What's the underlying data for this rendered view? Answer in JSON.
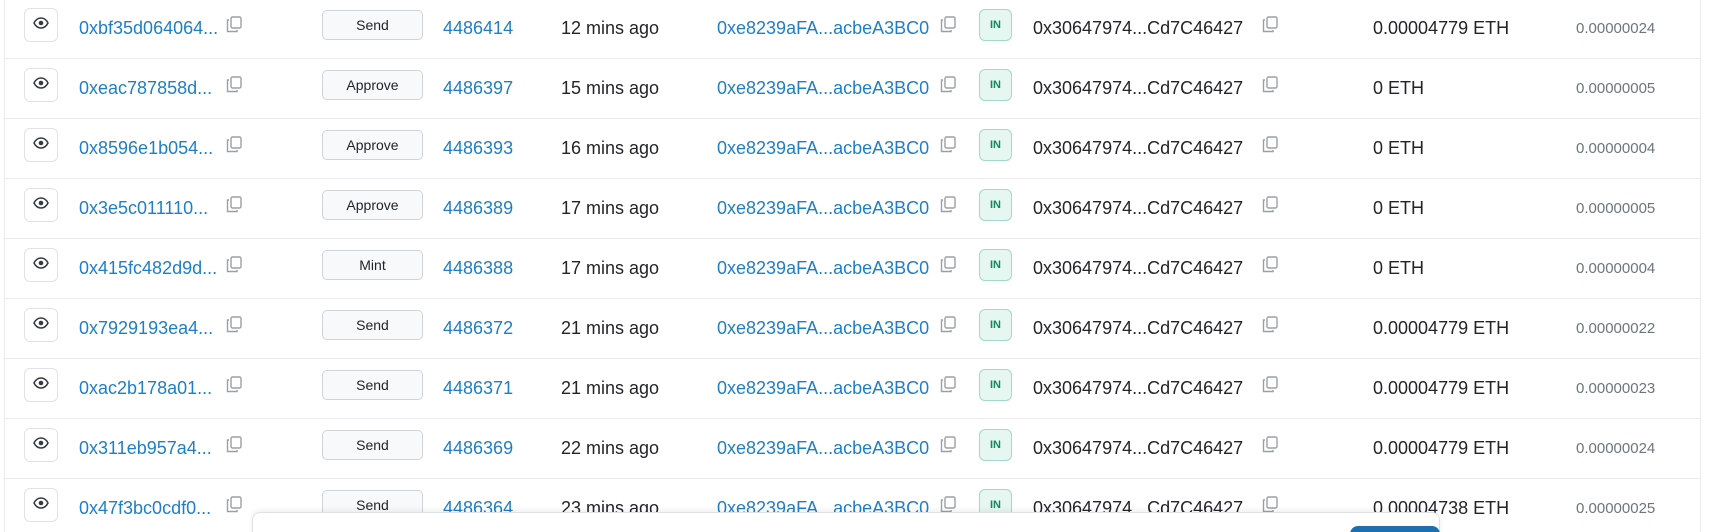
{
  "transactions": [
    {
      "hash": "0xbf35d064064...",
      "method": "Send",
      "block": "4486414",
      "age": "12 mins ago",
      "from": "0xe8239aFA...acbeA3BC0",
      "direction": "IN",
      "to": "0x30647974...Cd7C46427",
      "value": "0.00004779 ETH",
      "fee": "0.00000024"
    },
    {
      "hash": "0xeac787858d...",
      "method": "Approve",
      "block": "4486397",
      "age": "15 mins ago",
      "from": "0xe8239aFA...acbeA3BC0",
      "direction": "IN",
      "to": "0x30647974...Cd7C46427",
      "value": "0 ETH",
      "fee": "0.00000005"
    },
    {
      "hash": "0x8596e1b054...",
      "method": "Approve",
      "block": "4486393",
      "age": "16 mins ago",
      "from": "0xe8239aFA...acbeA3BC0",
      "direction": "IN",
      "to": "0x30647974...Cd7C46427",
      "value": "0 ETH",
      "fee": "0.00000004"
    },
    {
      "hash": "0x3e5c011110...",
      "method": "Approve",
      "block": "4486389",
      "age": "17 mins ago",
      "from": "0xe8239aFA...acbeA3BC0",
      "direction": "IN",
      "to": "0x30647974...Cd7C46427",
      "value": "0 ETH",
      "fee": "0.00000005"
    },
    {
      "hash": "0x415fc482d9d...",
      "method": "Mint",
      "block": "4486388",
      "age": "17 mins ago",
      "from": "0xe8239aFA...acbeA3BC0",
      "direction": "IN",
      "to": "0x30647974...Cd7C46427",
      "value": "0 ETH",
      "fee": "0.00000004"
    },
    {
      "hash": "0x7929193ea4...",
      "method": "Send",
      "block": "4486372",
      "age": "21 mins ago",
      "from": "0xe8239aFA...acbeA3BC0",
      "direction": "IN",
      "to": "0x30647974...Cd7C46427",
      "value": "0.00004779 ETH",
      "fee": "0.00000022"
    },
    {
      "hash": "0xac2b178a01...",
      "method": "Send",
      "block": "4486371",
      "age": "21 mins ago",
      "from": "0xe8239aFA...acbeA3BC0",
      "direction": "IN",
      "to": "0x30647974...Cd7C46427",
      "value": "0.00004779 ETH",
      "fee": "0.00000023"
    },
    {
      "hash": "0x311eb957a4...",
      "method": "Send",
      "block": "4486369",
      "age": "22 mins ago",
      "from": "0xe8239aFA...acbeA3BC0",
      "direction": "IN",
      "to": "0x30647974...Cd7C46427",
      "value": "0.00004779 ETH",
      "fee": "0.00000024"
    },
    {
      "hash": "0x47f3bc0cdf0...",
      "method": "Send",
      "block": "4486364",
      "age": "23 mins ago",
      "from": "0xe8239aFA...acbeA3BC0",
      "direction": "IN",
      "to": "0x30647974...Cd7C46427",
      "value": "0.00004738 ETH",
      "fee": "0.00000025"
    }
  ],
  "icons": {
    "view": "eye-icon",
    "copy": "copy-icon"
  },
  "colors": {
    "link": "#1e7fc4",
    "in_badge_bg": "#e6f6f0",
    "in_badge_text": "#0d8a5f",
    "muted": "#6c757d"
  }
}
